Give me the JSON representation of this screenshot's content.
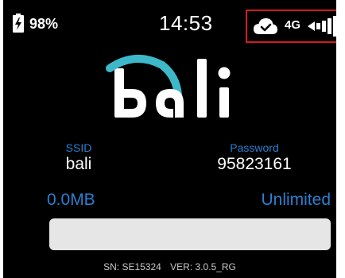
{
  "status_bar": {
    "battery_percent": "98%",
    "battery_icon": "battery-charging-icon",
    "time": "14:53",
    "cloud_icon": "cloud-check-icon",
    "network_type": "4G",
    "signal_icon": "signal-bars-icon",
    "highlight_color": "#d41c1c"
  },
  "logo": {
    "text": "bali",
    "colors": {
      "letters": "#ffffff",
      "arc": "#3db8c9"
    }
  },
  "wifi": {
    "ssid_label": "SSID",
    "ssid": "bali",
    "password_label": "Password",
    "password": "95823161"
  },
  "data_usage": {
    "used": "0.0MB",
    "limit": "Unlimited",
    "progress_fraction": 0.0
  },
  "footer": {
    "serial": "SN: SE15324",
    "version": "VER: 3.0.5_RG"
  },
  "colors": {
    "accent": "#2b7fd0",
    "background": "#000000",
    "progress_track": "#e6e6e6"
  }
}
